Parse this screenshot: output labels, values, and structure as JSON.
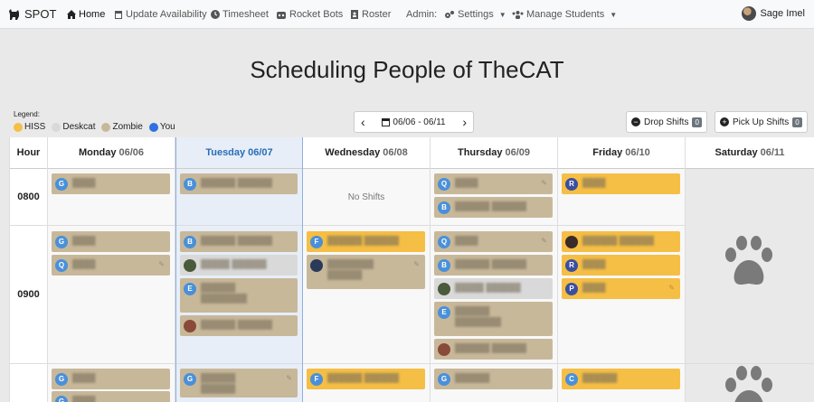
{
  "navbar": {
    "brand": "SPOT",
    "items": [
      {
        "label": "Home",
        "icon": "home-icon"
      },
      {
        "label": "Update Availability",
        "icon": "calendar-icon"
      },
      {
        "label": "Timesheet",
        "icon": "clock-icon"
      },
      {
        "label": "Rocket Bots",
        "icon": "robot-icon"
      },
      {
        "label": "Roster",
        "icon": "address-book-icon"
      }
    ],
    "admin_label": "Admin:",
    "settings_label": "Settings",
    "manage_label": "Manage Students",
    "user_name": "Sage Imel"
  },
  "page_title": "Scheduling People of TheCAT",
  "legend": {
    "label": "Legend:",
    "items": [
      {
        "label": "HISS",
        "color": "#f5be45"
      },
      {
        "label": "Deskcat",
        "color": "#d9d9d9"
      },
      {
        "label": "Zombie",
        "color": "#c8b89a"
      },
      {
        "label": "You",
        "color": "#2f6fe0"
      }
    ]
  },
  "week_nav": {
    "range": "06/06 - 06/11",
    "prev": "‹",
    "next": "›"
  },
  "buttons": {
    "drop": "Drop Shifts",
    "drop_count": "0",
    "pickup": "Pick Up Shifts",
    "pickup_count": "0"
  },
  "grid": {
    "hour_header": "Hour",
    "hours": [
      "0800",
      "0900"
    ],
    "days": [
      {
        "name": "Monday",
        "date": "06/06"
      },
      {
        "name": "Tuesday",
        "date": "06/07"
      },
      {
        "name": "Wednesday",
        "date": "06/08"
      },
      {
        "name": "Thursday",
        "date": "06/09"
      },
      {
        "name": "Friday",
        "date": "06/10"
      },
      {
        "name": "Saturday",
        "date": "06/11"
      }
    ],
    "no_shifts": "No Shifts",
    "shift_initials": {
      "mon": [
        "G",
        "G",
        "Q",
        "G",
        "G"
      ],
      "tue": [
        "B",
        "B",
        "E",
        "G"
      ],
      "wed": [
        "F",
        "F"
      ],
      "thu": [
        "Q",
        "B",
        "Q",
        "B",
        "E",
        "G"
      ],
      "fri": [
        "R",
        "R",
        "P",
        "C"
      ]
    },
    "initial_colors": {
      "blue": "#4a90d9",
      "navy": "#3b4fa0"
    }
  }
}
